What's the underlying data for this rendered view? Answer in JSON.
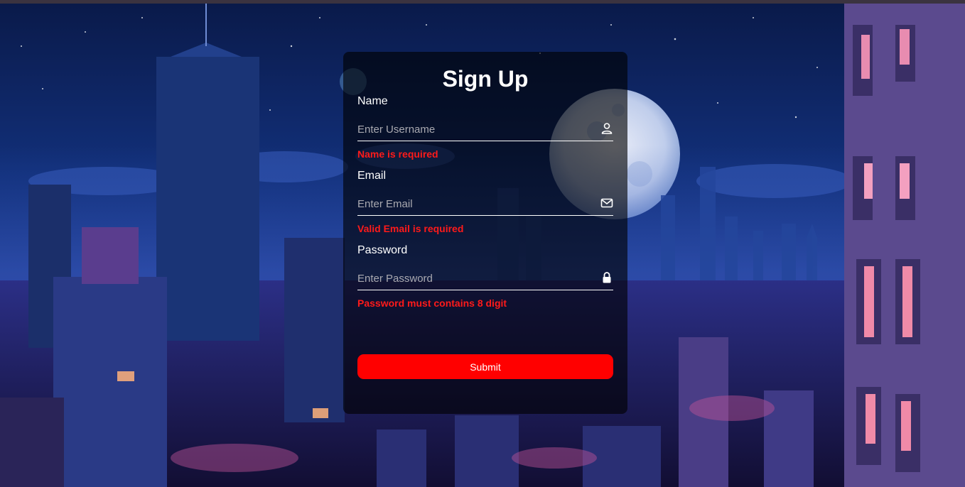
{
  "form": {
    "title": "Sign Up",
    "name": {
      "label": "Name",
      "placeholder": "Enter Username",
      "value": "",
      "icon": "user-icon",
      "error": "Name is required"
    },
    "email": {
      "label": "Email",
      "placeholder": "Enter Email",
      "value": "",
      "icon": "mail-icon",
      "error": "Valid Email is required"
    },
    "password": {
      "label": "Password",
      "placeholder": "Enter Password",
      "value": "",
      "icon": "lock-icon",
      "error": "Password must contains 8 digit"
    },
    "submit_label": "Submit"
  },
  "colors": {
    "error": "#ff1a1a",
    "submit": "#ff0000",
    "card": "rgba(0,0,0,0.62)",
    "text": "#ffffff"
  }
}
